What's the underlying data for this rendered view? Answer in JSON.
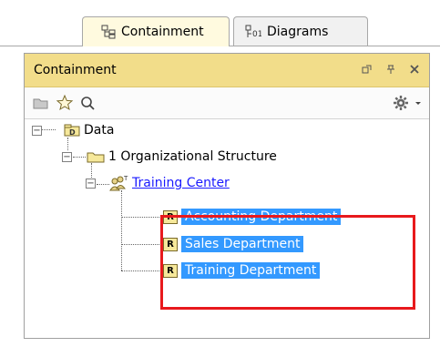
{
  "tabs": [
    {
      "label": "Containment",
      "icon": "containment-tree-icon"
    },
    {
      "label": "Diagrams",
      "icon": "diagrams-icon"
    }
  ],
  "panel": {
    "title": "Containment",
    "title_icons": [
      "restore-icon",
      "pin-icon",
      "close-icon"
    ]
  },
  "toolbar": {
    "icons": [
      "open-folder-icon",
      "favorite-star-icon",
      "search-icon",
      "settings-gear-icon",
      "dropdown-arrow-icon"
    ]
  },
  "tree": {
    "root": {
      "label": "Data",
      "icon": "package-icon"
    },
    "package": {
      "label": "1 Organizational Structure",
      "icon": "folder-icon"
    },
    "group": {
      "label": "Training Center",
      "icon": "organization-icon"
    },
    "items": [
      {
        "badge": "R",
        "label": "Accounting Department"
      },
      {
        "badge": "R",
        "label": "Sales Department"
      },
      {
        "badge": "R",
        "label": "Training Department"
      }
    ]
  },
  "colors": {
    "title_bar": "#f2dd8a",
    "selection": "#3399ff",
    "highlight_box": "#e8191c",
    "link": "#1a1aff"
  }
}
